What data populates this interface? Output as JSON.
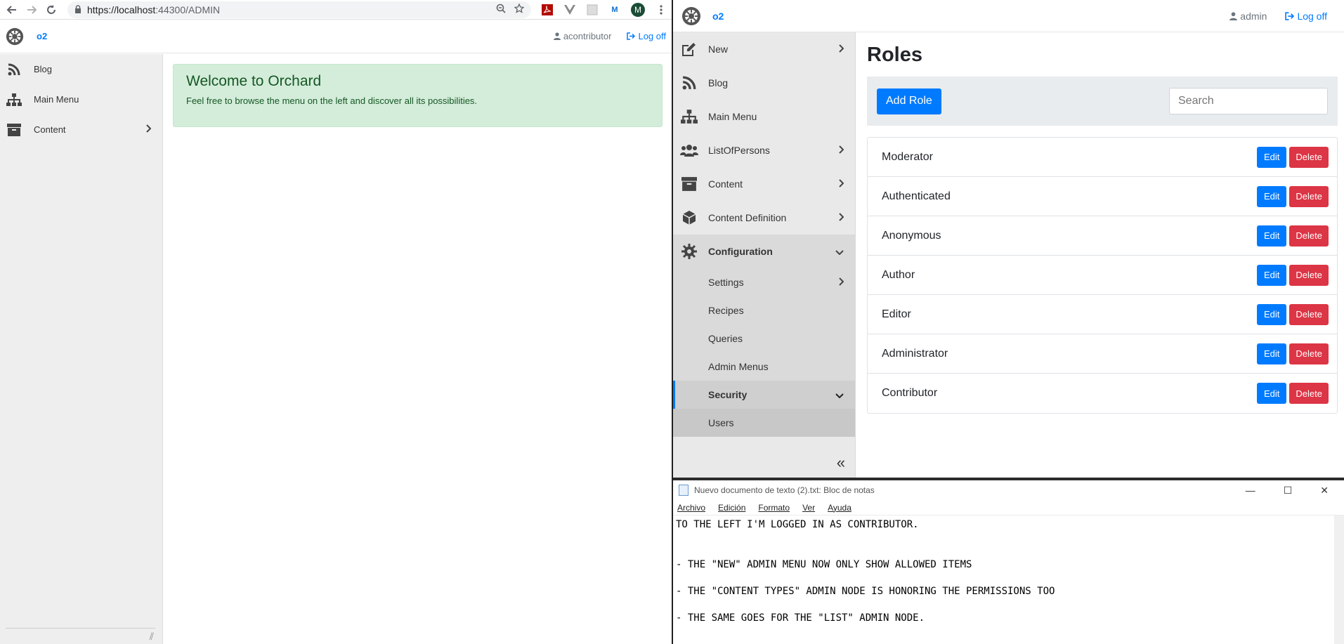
{
  "left": {
    "browser": {
      "url_host": "https://localhost",
      "url_path": ":44300/ADMIN",
      "avatar_letter": "M"
    },
    "site_name": "o2",
    "user": "acontributor",
    "logoff": "Log off",
    "sidebar": {
      "items": [
        {
          "label": "Blog",
          "icon": "rss-icon"
        },
        {
          "label": "Main Menu",
          "icon": "sitemap-icon"
        },
        {
          "label": "Content",
          "icon": "archive-icon"
        }
      ]
    },
    "welcome": {
      "title": "Welcome to Orchard",
      "text": "Feel free to browse the menu on the left and discover all its possibilities."
    }
  },
  "right": {
    "site_name": "o2",
    "user": "admin",
    "logoff": "Log off",
    "sidebar": {
      "items": [
        {
          "label": "New"
        },
        {
          "label": "Blog"
        },
        {
          "label": "Main Menu"
        },
        {
          "label": "ListOfPersons"
        },
        {
          "label": "Content"
        },
        {
          "label": "Content Definition"
        },
        {
          "label": "Configuration"
        }
      ],
      "sub": [
        {
          "label": "Settings"
        },
        {
          "label": "Recipes"
        },
        {
          "label": "Queries"
        },
        {
          "label": "Admin Menus"
        },
        {
          "label": "Security"
        },
        {
          "label": "Users"
        }
      ]
    },
    "main": {
      "title": "Roles",
      "add_label": "Add Role",
      "search_placeholder": "Search",
      "edit_label": "Edit",
      "delete_label": "Delete",
      "roles": [
        "Moderator",
        "Authenticated",
        "Anonymous",
        "Author",
        "Editor",
        "Administrator",
        "Contributor"
      ]
    }
  },
  "notepad": {
    "title": "Nuevo documento de texto (2).txt: Bloc de notas",
    "menu": [
      "Archivo",
      "Edición",
      "Formato",
      "Ver",
      "Ayuda"
    ],
    "lines": [
      "TO THE LEFT I'M LOGGED IN AS CONTRIBUTOR.",
      "",
      "",
      "- THE \"NEW\" ADMIN MENU NOW ONLY SHOW ALLOWED ITEMS",
      "",
      "- THE \"CONTENT TYPES\" ADMIN NODE IS HONORING THE PERMISSIONS TOO",
      "",
      "- THE SAME GOES FOR THE \"LIST\" ADMIN NODE."
    ]
  },
  "colors": {
    "primary": "#007bff",
    "danger": "#dc3545",
    "success_bg": "#d4edda",
    "success_text": "#155724"
  }
}
